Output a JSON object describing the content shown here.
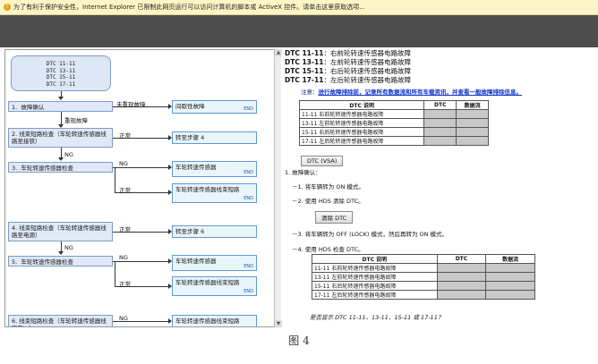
{
  "infobar": {
    "icon": "warning-shield-icon",
    "text": "为了有利于保护安全性，Internet Explorer 已限制此网页运行可以访问计算机的脚本或 ActiveX 控件。请单击这里获取选项..."
  },
  "flow": {
    "head_codes": [
      "DTC 11-11",
      "DTC 13-11",
      "DTC 15-11",
      "DTC 17-11"
    ],
    "steps": [
      {
        "num": "1.",
        "label": "故障确认"
      },
      {
        "num": "2.",
        "label": "线束短路检查（车轮转速传感器线路至接铁）"
      },
      {
        "num": "3.",
        "label": "车轮转速传感器检查"
      },
      {
        "num": "4.",
        "label": "线束短路检查（车轮转速传感器线路至电源）"
      },
      {
        "num": "5.",
        "label": "车轮转速传感器检查"
      },
      {
        "num": "6.",
        "label": "线束短路检查（车轮转速传感器线路至...）"
      }
    ],
    "links": {
      "not_reproduced": "未重现故障",
      "reproduced": "重现故障",
      "normal": "正常",
      "ng": "NG"
    },
    "results": {
      "intermittent": "间歇性故障",
      "goto4": "转至步骤 4",
      "sensor": "车轮转速传感器",
      "sensor_short": "车轮转速传感器线束短路",
      "goto6": "转至步骤 6",
      "end": "END"
    }
  },
  "detail": {
    "dtc_lines": [
      {
        "code": "DTC 11-11",
        "desc": "：右前轮转速传感器电路故障"
      },
      {
        "code": "DTC 13-11",
        "desc": "：左前轮转速传感器电路故障"
      },
      {
        "code": "DTC 15-11",
        "desc": "：右后轮转速传感器电路故障"
      },
      {
        "code": "DTC 17-11",
        "desc": "：左后轮转速传感器电路故障"
      }
    ],
    "note_prefix": "注意：",
    "note_link": "进行故障排除前，记录所有数据流和所有车载资讯，并查看一般故障排除信息。",
    "table_headers": [
      "DTC 说明",
      "DTC",
      "数据流"
    ],
    "table_rows": [
      "11-11 右前轮转速传感器电路故障",
      "13-11 左前轮转速传感器电路故障",
      "15-11 右后轮转速传感器电路故障",
      "17-11 左后轮转速传感器电路故障"
    ],
    "vsa_button": "DTC (VSA)",
    "section_title": "1. 故障确认：",
    "sub1": "－1. 将车辆转为 ON 模式。",
    "sub2": "－2. 使用 HDS 清除 DTC。",
    "clear_button": "清除 DTC",
    "sub3": "－3. 将车辆转为 OFF (LOCK) 模式，然后再转为 ON 模式。",
    "sub4": "－4. 使用 HDS 检查 DTC。",
    "table2_rows": [
      "11-11 右前轮转速传感器电路故障",
      "13-11 左前轮转速传感器电路故障",
      "15-11 右后轮转速传感器电路故障",
      "17-11 左后轮转速传感器电路故障"
    ],
    "footer_question": "是否显示 DTC 11-11、13-11、15-11 或 17-11？"
  },
  "caption": "图 4"
}
